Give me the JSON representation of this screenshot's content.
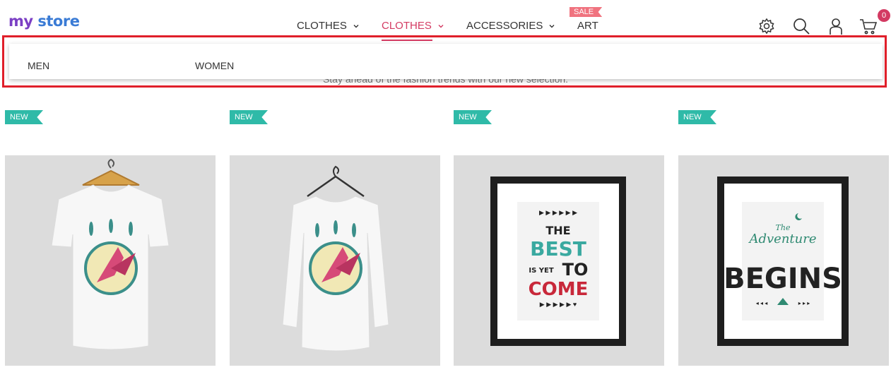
{
  "logo": {
    "part1": "my",
    "part2": "store"
  },
  "nav": {
    "items": [
      {
        "label": "CLOTHES"
      },
      {
        "label": "CLOTHES"
      },
      {
        "label": "ACCESSORIES"
      },
      {
        "label": "ART"
      }
    ],
    "sale_badge": "SALE"
  },
  "header": {
    "cart_count": "0"
  },
  "dropdown": {
    "men_label": "MEN",
    "women_label": "WOMEN"
  },
  "hero": {
    "subtitle": "Stay ahead of the fashion trends with our new selection."
  },
  "products": [
    {
      "flag": "NEW"
    },
    {
      "flag": "NEW"
    },
    {
      "flag": "NEW",
      "poster_lines": [
        "THE",
        "BEST",
        "IS YET",
        "TO",
        "COME"
      ]
    },
    {
      "flag": "NEW",
      "poster_lines": [
        "The",
        "Adventure",
        "BEGINS"
      ]
    }
  ],
  "colors": {
    "accent": "#d33a62",
    "new_flag": "#2fbaa8",
    "sale": "#f0737f",
    "highlight": "#e01f2a"
  },
  "icons": [
    "gear-icon",
    "search-icon",
    "user-icon",
    "cart-icon",
    "chevron-down-icon"
  ]
}
